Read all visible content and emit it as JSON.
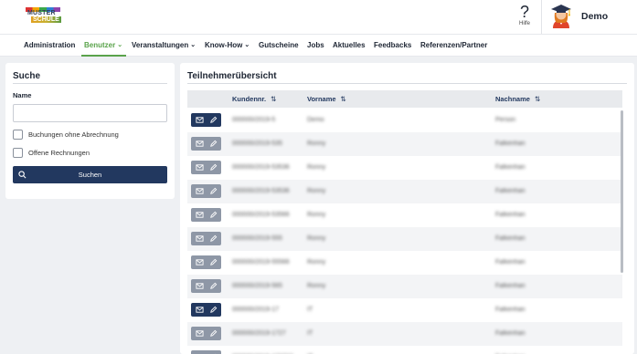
{
  "header": {
    "logo_line1": "MUSTER",
    "logo_line2": "SCHULE",
    "help_label": "Hilfe",
    "user_name": "Demo"
  },
  "nav": {
    "items": [
      {
        "label": "Administration",
        "dropdown": false,
        "active": false
      },
      {
        "label": "Benutzer",
        "dropdown": true,
        "active": true
      },
      {
        "label": "Veranstaltungen",
        "dropdown": true,
        "active": false
      },
      {
        "label": "Know-How",
        "dropdown": true,
        "active": false
      },
      {
        "label": "Gutscheine",
        "dropdown": false,
        "active": false
      },
      {
        "label": "Jobs",
        "dropdown": false,
        "active": false
      },
      {
        "label": "Aktuelles",
        "dropdown": false,
        "active": false
      },
      {
        "label": "Feedbacks",
        "dropdown": false,
        "active": false
      },
      {
        "label": "Referenzen/Partner",
        "dropdown": false,
        "active": false
      }
    ]
  },
  "search": {
    "title": "Suche",
    "name_label": "Name",
    "name_value": "",
    "checkbox_billing": "Buchungen ohne Abrechnung",
    "checkbox_invoices": "Offene Rechnungen",
    "button_label": "Suchen"
  },
  "list": {
    "title": "Teilnehmerübersicht",
    "columns": {
      "customer_no": "Kundennr.",
      "first_name": "Vorname",
      "last_name": "Nachname"
    },
    "rows": [
      {
        "customer_no": "000000/2019-5",
        "first_name": "Demo",
        "last_name": "Person",
        "action_style": "dark"
      },
      {
        "customer_no": "000000/2019-535",
        "first_name": "Ronny",
        "last_name": "Falkenhan",
        "action_style": "grey"
      },
      {
        "customer_no": "000000/2019-53536",
        "first_name": "Ronny",
        "last_name": "Falkenhan",
        "action_style": "grey"
      },
      {
        "customer_no": "000000/2019-53536",
        "first_name": "Ronny",
        "last_name": "Falkenhan",
        "action_style": "grey"
      },
      {
        "customer_no": "000000/2019-53566",
        "first_name": "Ronny",
        "last_name": "Falkenhan",
        "action_style": "grey"
      },
      {
        "customer_no": "000000/2019-555",
        "first_name": "Ronny",
        "last_name": "Falkenhan",
        "action_style": "grey"
      },
      {
        "customer_no": "000000/2019-55566",
        "first_name": "Ronny",
        "last_name": "Falkenhan",
        "action_style": "grey"
      },
      {
        "customer_no": "000000/2019-565",
        "first_name": "Ronny",
        "last_name": "Falkenhan",
        "action_style": "grey"
      },
      {
        "customer_no": "000000/2019-17",
        "first_name": "IT",
        "last_name": "Falkenhan",
        "action_style": "dark"
      },
      {
        "customer_no": "000000/2019-1727",
        "first_name": "IT",
        "last_name": "Falkenhan",
        "action_style": "grey"
      },
      {
        "customer_no": "000000/2019-172727",
        "first_name": "IT",
        "last_name": "Falkenhan",
        "action_style": "grey"
      }
    ]
  },
  "colors": {
    "primary": "#22385f",
    "accent": "#5aa34b",
    "muted_action": "#8e97a6"
  }
}
